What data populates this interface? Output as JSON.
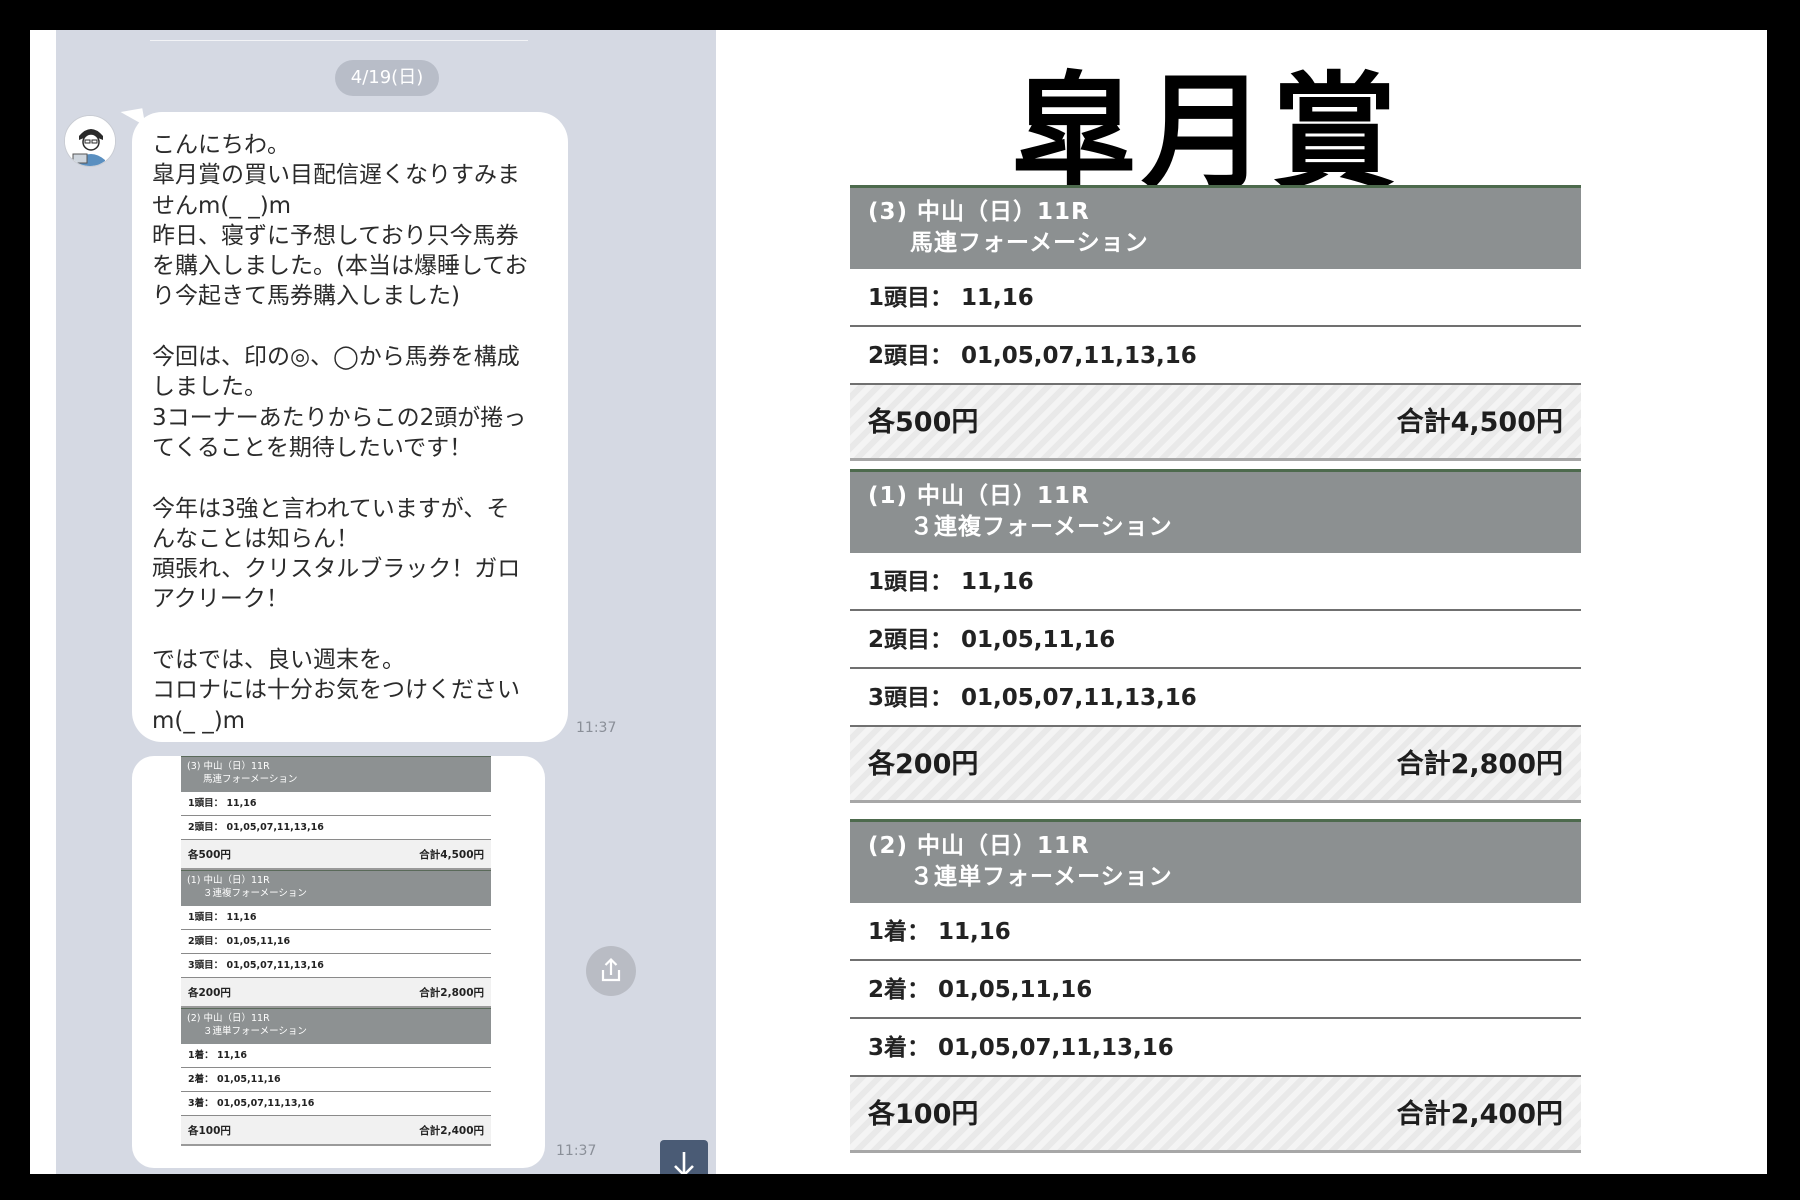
{
  "chat": {
    "date": "4/19(日)",
    "message_lines": [
      "こんにちわ。",
      "皐月賞の買い目配信遅くなりすみま",
      "せんm(_ _)m",
      "昨日、寝ずに予想しており只今馬券",
      "を購入しました。(本当は爆睡してお",
      "り今起きて馬券購入しました)",
      "",
      "今回は、印の◎、◯から馬券を構成",
      "しました。",
      "3コーナーあたりからこの2頭が捲っ",
      "てくることを期待したいです！",
      "",
      "今年は3強と言われていますが、そ",
      "んなことは知らん！",
      "頑張れ、クリスタルブラック！ガロ",
      "アクリーク！",
      "",
      "ではでは、良い週末を。",
      "コロナには十分お気をつけください",
      "m(_ _)m"
    ],
    "time1": "11:37",
    "time2": "11:37"
  },
  "race_title": "皐月賞",
  "bets": [
    {
      "header": "(3) 中山（日）11R",
      "type": "馬連フォーメーション",
      "rows": [
        {
          "label": "1頭目：",
          "value": "11,16"
        },
        {
          "label": "2頭目：",
          "value": "01,05,07,11,13,16"
        }
      ],
      "each": "各500円",
      "total": "合計4,500円"
    },
    {
      "header": "(1) 中山（日）11R",
      "type": "３連複フォーメーション",
      "rows": [
        {
          "label": "1頭目：",
          "value": "11,16"
        },
        {
          "label": "2頭目：",
          "value": "01,05,11,16"
        },
        {
          "label": "3頭目：",
          "value": "01,05,07,11,13,16"
        }
      ],
      "each": "各200円",
      "total": "合計2,800円"
    },
    {
      "header": "(2) 中山（日）11R",
      "type": "３連単フォーメーション",
      "rows": [
        {
          "label": "1着：",
          "value": "11,16"
        },
        {
          "label": "2着：",
          "value": "01,05,11,16"
        },
        {
          "label": "3着：",
          "value": "01,05,07,11,13,16"
        }
      ],
      "each": "各100円",
      "total": "合計2,400円"
    }
  ],
  "icons": {
    "avatar": "avatar-icon",
    "share": "share-icon",
    "scroll_down": "arrow-down-icon"
  },
  "colors": {
    "chat_bg": "#d5d9e3",
    "bubble": "#ffffff",
    "bet_header": "#8c9091",
    "scroll_button": "#4a5b75"
  }
}
